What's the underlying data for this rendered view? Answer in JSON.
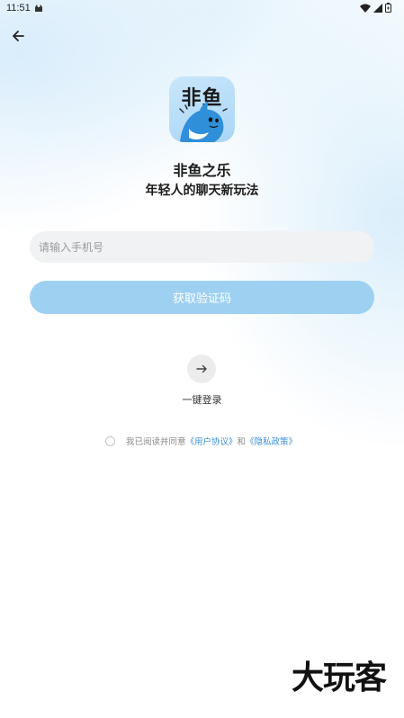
{
  "status_bar": {
    "time": "11:51",
    "icons": [
      "android-notification-icon",
      "wifi-icon",
      "signal-icon",
      "battery-icon"
    ]
  },
  "header": {
    "back_icon": "arrow-left-icon"
  },
  "app": {
    "logo_text": "非鱼",
    "name": "非鱼之乐",
    "tagline": "年轻人的聊天新玩法"
  },
  "login": {
    "phone_placeholder": "请输入手机号",
    "phone_value": "",
    "get_code_label": "获取验证码",
    "one_key_icon": "arrow-right-icon",
    "one_key_label": "一键登录"
  },
  "agreement": {
    "checked": false,
    "prefix": "我已阅读并同意",
    "user_agreement": "《用户协议》",
    "conjunction": "和",
    "privacy_policy": "《隐私政策》"
  },
  "watermark": "大玩客",
  "colors": {
    "primary_disabled": "#9ed0f2",
    "link": "#3a8fd8",
    "input_bg": "#f1f2f3"
  }
}
